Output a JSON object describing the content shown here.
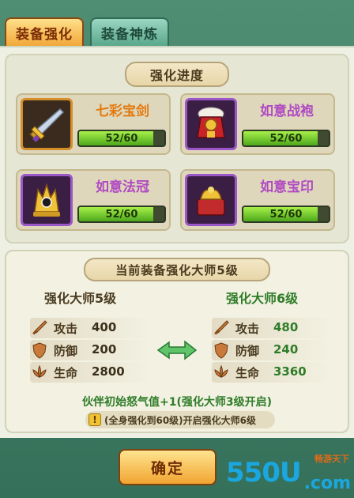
{
  "tabs": [
    {
      "label": "装备强化",
      "active": true
    },
    {
      "label": "装备神炼",
      "active": false
    }
  ],
  "progress": {
    "title": "强化进度",
    "items": [
      {
        "name": "七彩宝剑",
        "progress": "52/60",
        "current": 52,
        "max": 60,
        "icon": "rainbow-sword-icon",
        "rarity": "orange"
      },
      {
        "name": "如意战袍",
        "progress": "52/60",
        "current": 52,
        "max": 60,
        "icon": "battle-robe-icon",
        "rarity": "purple"
      },
      {
        "name": "如意法冠",
        "progress": "52/60",
        "current": 52,
        "max": 60,
        "icon": "magic-crown-icon",
        "rarity": "purple"
      },
      {
        "name": "如意宝印",
        "progress": "52/60",
        "current": 52,
        "max": 60,
        "icon": "treasure-seal-icon",
        "rarity": "purple"
      }
    ]
  },
  "master": {
    "title": "当前装备强化大师5级",
    "current_label": "强化大师5级",
    "next_label": "强化大师6级",
    "stats": [
      {
        "name": "攻击",
        "current": "400",
        "next": "480",
        "icon": "attack-sword-icon"
      },
      {
        "name": "防御",
        "current": "200",
        "next": "240",
        "icon": "defense-shield-icon"
      },
      {
        "name": "生命",
        "current": "2800",
        "next": "3360",
        "icon": "health-lotus-icon"
      }
    ],
    "bonus": "伙伴初始怒气值+1(强化大师3级开启)",
    "hint": "(全身强化到60级)开启强化大师6级"
  },
  "confirm_label": "确定",
  "watermark": {
    "main": "550U",
    "sub1": "畅游天下",
    "sub2": ".com"
  }
}
